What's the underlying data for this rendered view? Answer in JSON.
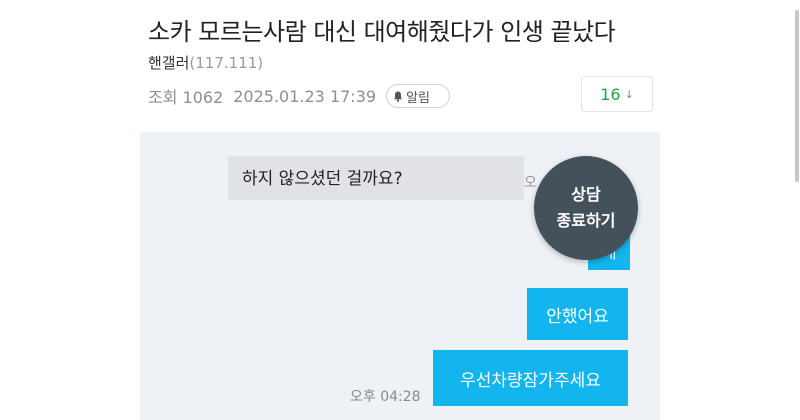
{
  "post": {
    "title": "소카 모르는사람 대신 대여해줬다가 인생 끝났다",
    "author": "핸갤러",
    "author_ip": "(117.111)",
    "views_label": "조회 1062",
    "date": "2025.01.23 17:39",
    "alarm_label": "알림",
    "comment_count": "16"
  },
  "chat": {
    "left_message": "하지 않으셨던 걸까요?",
    "left_time_partial": "오",
    "bubble_1": "네",
    "bubble_2": "안했어요",
    "bubble_3": "우선차량잠가주세요",
    "bottom_time": "오후 04:28",
    "end_button_line1": "상담",
    "end_button_line2": "종료하기"
  },
  "colors": {
    "blue_bubble": "#12b5ee",
    "comment_count": "#1fa34a",
    "end_button": "#44505a"
  },
  "icons": [
    "bell-icon",
    "down-arrow-icon"
  ]
}
